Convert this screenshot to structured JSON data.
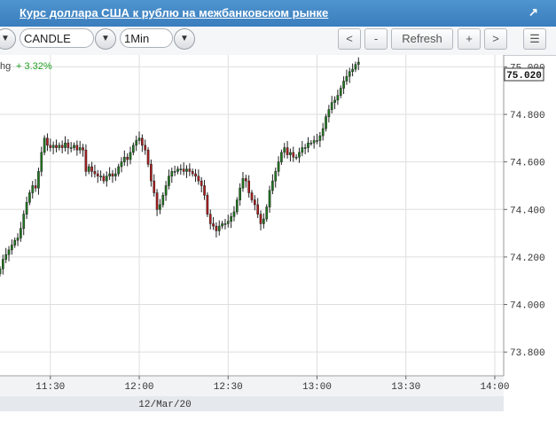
{
  "window": {
    "title": "Курс доллара США к рублю на межбанковском рынке",
    "popout_icon": "↗"
  },
  "toolbar": {
    "prev_dropdown_icon": "chevron-down-icon",
    "chart_type": "CANDLE",
    "interval": "1Min",
    "scroll_left_label": "<",
    "zoom_out_label": "-",
    "refresh_label": "Refresh",
    "zoom_in_label": "+",
    "scroll_right_label": ">",
    "menu_icon": "list-icon"
  },
  "chart_data": {
    "type": "candlestick",
    "legend_text": "hg",
    "change_text": "+ 3.32%",
    "last_value_label": "75.020",
    "ylim": [
      73.7,
      75.05
    ],
    "y_ticks": [
      "73.800",
      "74.000",
      "74.200",
      "74.400",
      "74.600",
      "74.800",
      "75.000"
    ],
    "x_ticks": [
      {
        "time": "11:30",
        "minutes": 690
      },
      {
        "time": "12:00",
        "minutes": 720
      },
      {
        "time": "12:30",
        "minutes": 750
      },
      {
        "time": "13:00",
        "minutes": 780
      },
      {
        "time": "13:30",
        "minutes": 810
      },
      {
        "time": "14:00",
        "minutes": 840
      }
    ],
    "xlim_minutes": [
      673,
      843
    ],
    "date_label": "12/Mar/20",
    "grid": true,
    "up_color": "#1f7a1f",
    "down_color": "#b01c1c",
    "close_series_start_minute": 673,
    "close_series": [
      74.15,
      74.19,
      74.21,
      74.23,
      74.25,
      74.27,
      74.28,
      74.32,
      74.38,
      74.43,
      74.47,
      74.5,
      74.49,
      74.56,
      74.64,
      74.7,
      74.67,
      74.66,
      74.67,
      74.66,
      74.67,
      74.66,
      74.68,
      74.66,
      74.66,
      74.67,
      74.65,
      74.66,
      74.65,
      74.56,
      74.58,
      74.56,
      74.55,
      74.54,
      74.54,
      74.52,
      74.54,
      74.55,
      74.54,
      74.55,
      74.58,
      74.6,
      74.62,
      74.61,
      74.64,
      74.67,
      74.69,
      74.7,
      74.67,
      74.65,
      74.59,
      74.52,
      74.47,
      74.4,
      74.42,
      74.46,
      74.5,
      74.54,
      74.56,
      74.56,
      74.57,
      74.57,
      74.56,
      74.57,
      74.56,
      74.55,
      74.54,
      74.52,
      74.5,
      74.46,
      74.38,
      74.34,
      74.33,
      74.31,
      74.33,
      74.34,
      74.34,
      74.35,
      74.37,
      74.39,
      74.44,
      74.49,
      74.53,
      74.52,
      74.47,
      74.44,
      74.42,
      74.38,
      74.34,
      74.36,
      74.41,
      74.48,
      74.52,
      74.56,
      74.6,
      74.64,
      74.66,
      74.63,
      74.64,
      74.62,
      74.62,
      74.64,
      74.66,
      74.66,
      74.68,
      74.68,
      74.69,
      74.69,
      74.71,
      74.74,
      74.79,
      74.82,
      74.85,
      74.86,
      74.88,
      74.91,
      74.94,
      74.96,
      74.98,
      74.99,
      75.01,
      75.02
    ]
  }
}
